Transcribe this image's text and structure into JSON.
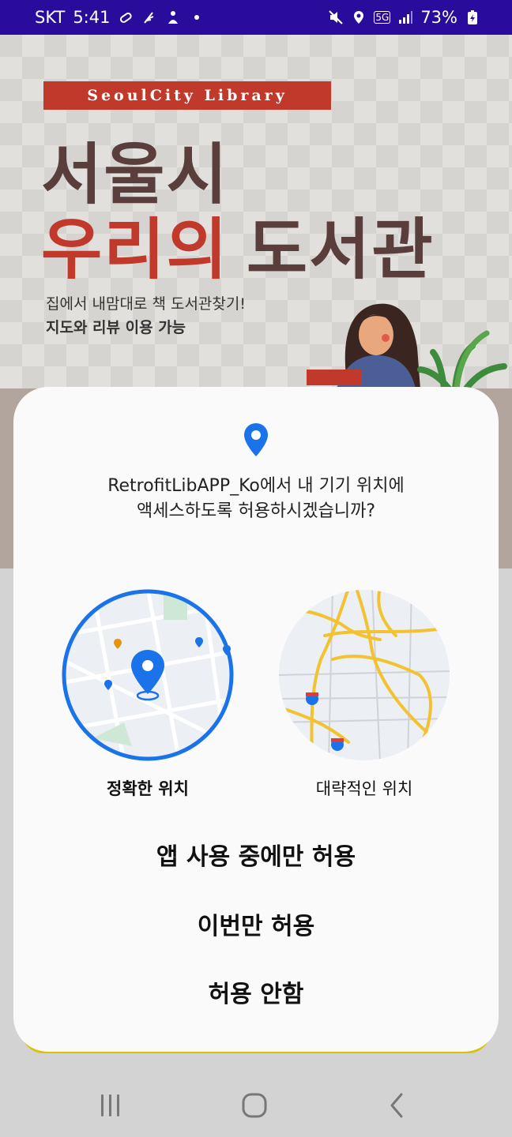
{
  "status_bar": {
    "carrier": "SKT",
    "time": "5:41",
    "battery": "73%",
    "network": "5G"
  },
  "banner": {
    "tag": "SeoulCity Library",
    "title_line1": "서울시",
    "title_line2_highlight": "우리의",
    "title_line2_rest": "도서관",
    "subtitle1": "집에서 내맘대로 책 도서관찾기!",
    "subtitle2": "지도와 리뷰 이용 가능"
  },
  "dialog": {
    "message_line1": "RetrofitLibAPP_Ko에서 내 기기 위치에",
    "message_line2": "액세스하도록 허용하시겠습니까?",
    "options": {
      "precise": "정확한 위치",
      "approximate": "대략적인 위치"
    },
    "buttons": {
      "while_using": "앱 사용 중에만 허용",
      "only_this_time": "이번만 허용",
      "deny": "허용 안함"
    }
  },
  "colors": {
    "status_bar": "#2a0c9c",
    "accent_blue": "#1a73e8",
    "banner_red": "#c0392b"
  }
}
